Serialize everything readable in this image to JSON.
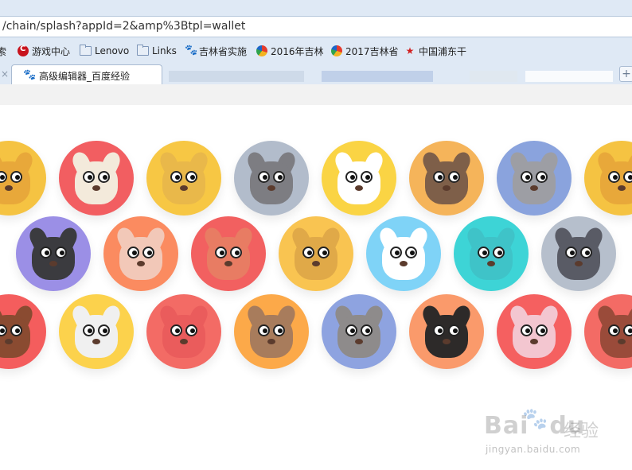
{
  "address_bar": {
    "url": "/chain/splash?appId=2&amp%3Btpl=wallet"
  },
  "bookmarks": [
    {
      "label": "索",
      "icon": "none"
    },
    {
      "label": "游戏中心",
      "icon": "game-center-icon"
    },
    {
      "label": "Lenovo",
      "icon": "folder-icon"
    },
    {
      "label": "Links",
      "icon": "folder-icon"
    },
    {
      "label": "吉林省实施",
      "icon": "baidu-paw-icon"
    },
    {
      "label": "2016年吉林",
      "icon": "colorful-flame-icon"
    },
    {
      "label": "2017吉林省",
      "icon": "colorful-flame-icon"
    },
    {
      "label": "中国浦东干",
      "icon": "pudong-logo-icon"
    }
  ],
  "tabs": {
    "active_label": "高级编辑器_百度经验",
    "close_glyph": "×",
    "new_tab_glyph": "+"
  },
  "colors": {
    "chrome_bg": "#dfe9f5",
    "page_bg": "#ffffff"
  },
  "cats": [
    {
      "bg": "#f5c342",
      "face": "#e8a83a",
      "row": 0
    },
    {
      "bg": "#f25e61",
      "face": "#f3eadb",
      "row": 0
    },
    {
      "bg": "#f7c744",
      "face": "#e9b84a",
      "row": 0
    },
    {
      "bg": "#b2bccb",
      "face": "#7d7d82",
      "row": 0
    },
    {
      "bg": "#fad444",
      "face": "#ffffff",
      "row": 0
    },
    {
      "bg": "#f5b45a",
      "face": "#7e5f49",
      "row": 0
    },
    {
      "bg": "#8aa3dd",
      "face": "#9d9ea4",
      "row": 0
    },
    {
      "bg": "#f5c342",
      "face": "#e8a83a",
      "row": 0
    },
    {
      "bg": "#9b8fe6",
      "face": "#3b3b3f",
      "row": 1
    },
    {
      "bg": "#fb8b60",
      "face": "#f2c8b8",
      "row": 1
    },
    {
      "bg": "#f26060",
      "face": "#e87c63",
      "row": 1
    },
    {
      "bg": "#f9c451",
      "face": "#e0a948",
      "row": 1
    },
    {
      "bg": "#7fd3f7",
      "face": "#ffffff",
      "row": 1
    },
    {
      "bg": "#3dd4d6",
      "face": "#3fc3c8",
      "row": 1
    },
    {
      "bg": "#b6bfcc",
      "face": "#595b65",
      "row": 1
    },
    {
      "bg": "#f45d5d",
      "face": "#8a4b31",
      "row": 2
    },
    {
      "bg": "#fcd24c",
      "face": "#f0f0f0",
      "row": 2
    },
    {
      "bg": "#f36b65",
      "face": "#ea5c5c",
      "row": 2
    },
    {
      "bg": "#fca949",
      "face": "#a87c5c",
      "row": 2
    },
    {
      "bg": "#8ea3e0",
      "face": "#8e8b8b",
      "row": 2
    },
    {
      "bg": "#fa9a6b",
      "face": "#2d2a29",
      "row": 2
    },
    {
      "bg": "#f56060",
      "face": "#f3c6d0",
      "row": 2
    },
    {
      "bg": "#f36b65",
      "face": "#9a4b3a",
      "row": 2
    }
  ],
  "watermark": {
    "brand": "Bai",
    "brand_du": "du",
    "cn": "经验",
    "url": "jingyan.baidu.com"
  }
}
